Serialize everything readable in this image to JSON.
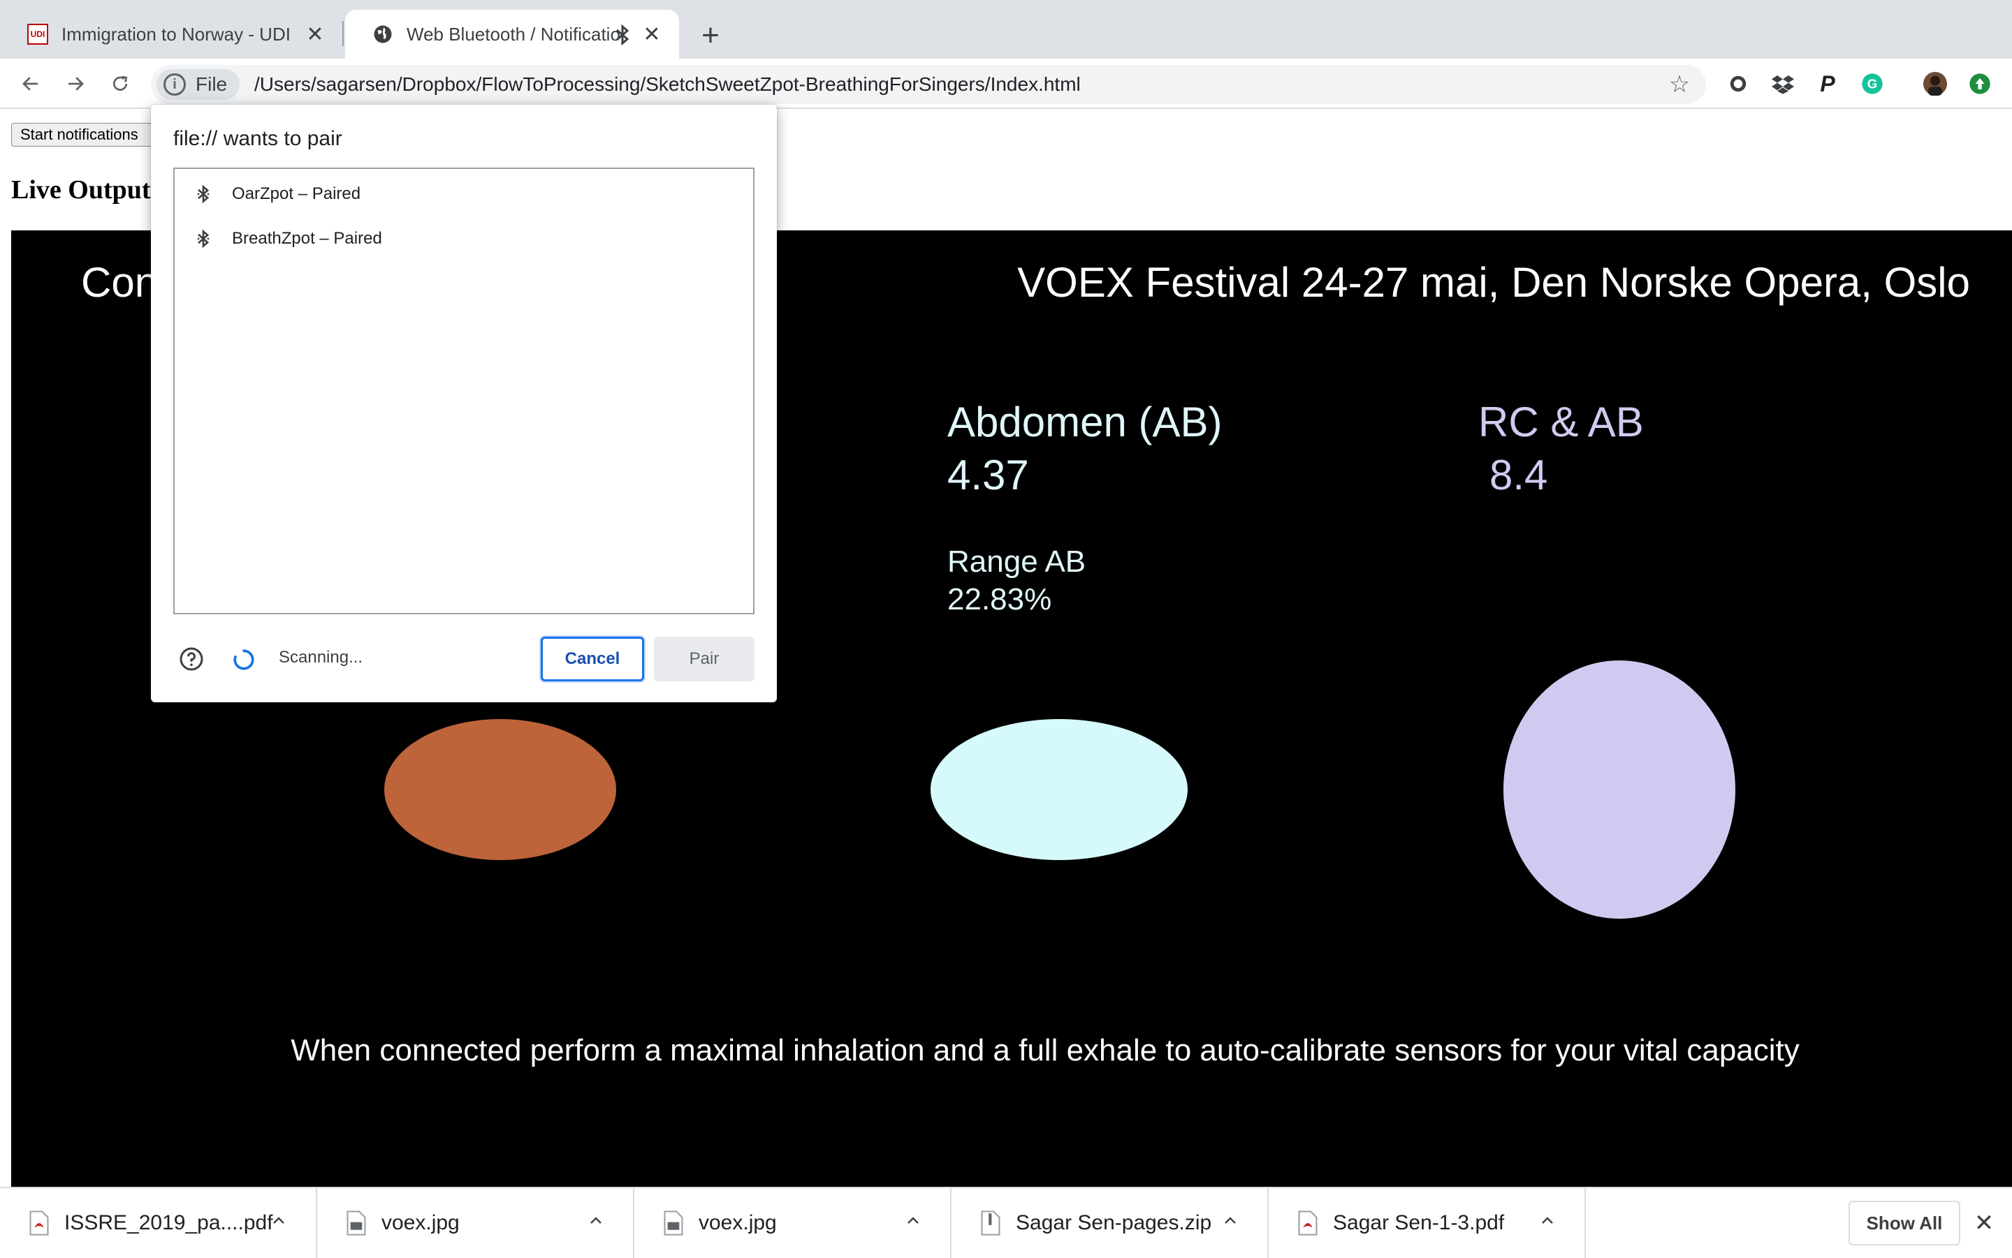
{
  "tabs": [
    {
      "title": "Immigration to Norway - UDI",
      "favicon": "udi-logo",
      "favicon_text": "UDI"
    },
    {
      "title": "Web Bluetooth / Notifications",
      "favicon": "globe-icon",
      "indicator": "bluetooth-icon"
    }
  ],
  "toolbar": {
    "site_chip": "File",
    "url": "/Users/sagarsen/Dropbox/FlowToProcessing/SketchSweetZpot-BreathingForSingers/Index.html"
  },
  "page": {
    "start_button": "Start notifications",
    "live_output": "Live Output",
    "canvas": {
      "title_left": "Con",
      "title_right": "VOEX Festival 24-27 mai, Den Norske Opera, Oslo",
      "ab_label": "Abdomen (AB)",
      "ab_value": "4.37",
      "rcab_label": "RC & AB",
      "rcab_value": "8.4",
      "range_label": "Range AB",
      "range_value": "22.83%",
      "instruction": "When connected perform a maximal inhalation and a full exhale to auto-calibrate sensors for your vital capacity",
      "colors": {
        "rc": "#bd643a",
        "ab": "#d6f9fb",
        "rcab": "#cfcbf0"
      }
    }
  },
  "dialog": {
    "heading": "file:// wants to pair",
    "devices": [
      {
        "label": "OarZpot – Paired"
      },
      {
        "label": "BreathZpot – Paired"
      }
    ],
    "status": "Scanning...",
    "cancel": "Cancel",
    "pair": "Pair"
  },
  "downloads": {
    "items": [
      {
        "name": "ISSRE_2019_pa....pdf",
        "type": "pdf"
      },
      {
        "name": "voex.jpg",
        "type": "jpg"
      },
      {
        "name": "voex.jpg",
        "type": "jpg"
      },
      {
        "name": "Sagar Sen-pages.zip",
        "type": "zip"
      },
      {
        "name": "Sagar Sen-1-3.pdf",
        "type": "pdf"
      }
    ],
    "show_all": "Show All"
  }
}
